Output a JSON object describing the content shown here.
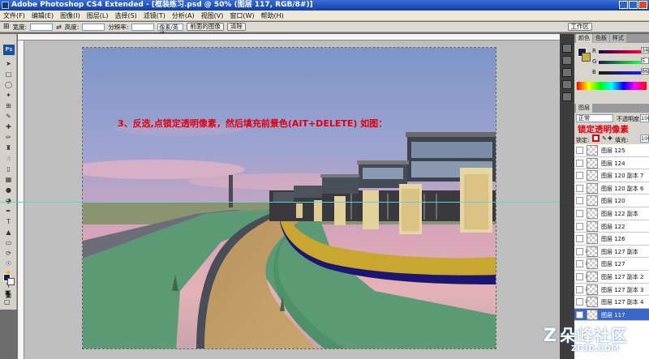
{
  "window": {
    "title": "Adobe Photoshop CS4 Extended - [框装练习.psd @ 50% (图层 117, RGB/8#)]"
  },
  "menu": [
    "文件(F)",
    "编辑(E)",
    "图像(I)",
    "图层(L)",
    "选择(S)",
    "滤镜(T)",
    "分析(A)",
    "视图(V)",
    "窗口(W)",
    "帮助(H)"
  ],
  "options": {
    "width_label": "宽度:",
    "height_label": "高度:",
    "resolution_label": "分辨率:",
    "unit_select": "像素/英寸",
    "front_image_button": "前面的图像",
    "clear_button": "清除",
    "workspace": "工作区"
  },
  "toolbox": {
    "logo": "Ps"
  },
  "annotation": "3、反选,点锁定透明像素，然后填充前景色(AIT+DELETE) 如图：",
  "color_panel": {
    "tabs": [
      "颜色",
      "色板",
      "样式"
    ],
    "channels": [
      {
        "label": "R",
        "value": "34"
      },
      {
        "label": "G",
        "value": "5"
      },
      {
        "label": "B",
        "value": "86"
      }
    ],
    "foreground": "#1a1b4a",
    "background": "#c8b040"
  },
  "layers_panel": {
    "tab": "图层",
    "blend_mode": "正常",
    "opacity_label": "不透明度:",
    "opacity_value": "100",
    "lock_label": "锁定:",
    "lock_tip": "锁定透明像素",
    "fill_label": "填充:",
    "fill_value": "100",
    "layers": [
      {
        "name": "图层 125",
        "linked": false,
        "selected": false
      },
      {
        "name": "图层 124",
        "linked": false,
        "selected": false
      },
      {
        "name": "图层 120 副本 7",
        "linked": false,
        "selected": false
      },
      {
        "name": "图层 120 副本 6",
        "linked": false,
        "selected": false
      },
      {
        "name": "图层 120",
        "linked": false,
        "selected": false
      },
      {
        "name": "图层 122 副本",
        "linked": false,
        "selected": false
      },
      {
        "name": "图层 122",
        "linked": false,
        "selected": false
      },
      {
        "name": "图层 126",
        "linked": false,
        "selected": false
      },
      {
        "name": "图层 127 副本",
        "linked": true,
        "selected": false
      },
      {
        "name": "图层 127",
        "linked": true,
        "selected": false
      },
      {
        "name": "图层 127 副本 2",
        "linked": true,
        "selected": false
      },
      {
        "name": "图层 127 副本 3",
        "linked": true,
        "selected": false
      },
      {
        "name": "图层 127 副本 4",
        "linked": true,
        "selected": false
      },
      {
        "name": "图层 117",
        "linked": false,
        "selected": true
      }
    ]
  },
  "watermark": {
    "text": "朵峰社区",
    "url": "ZF3D.COM",
    "logo": "Z"
  }
}
